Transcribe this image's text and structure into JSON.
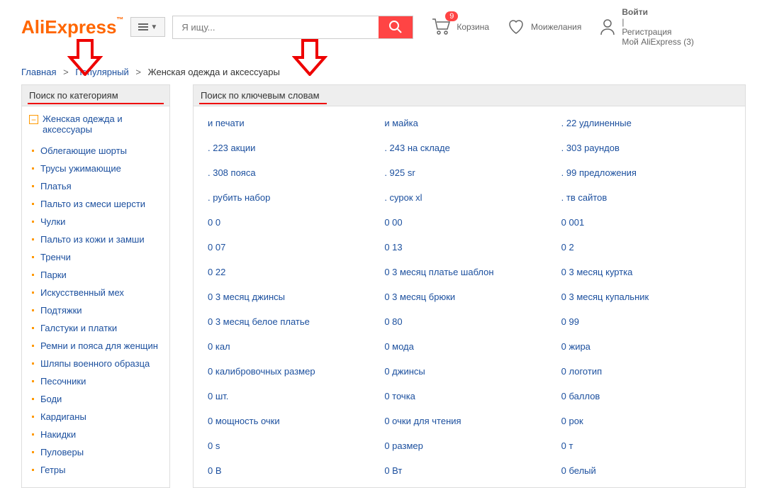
{
  "header": {
    "logo": {
      "ali": "Ali",
      "express": "Express",
      "tm": "™"
    },
    "search": {
      "placeholder": "Я ищу..."
    },
    "cart": {
      "count": "9",
      "label": "Корзина"
    },
    "wishlist": {
      "top": "Мои",
      "bot": "желания"
    },
    "account": {
      "login": "Войти",
      "sep": "|",
      "register": "Регистрация",
      "my": "Мой AliExpress (3)"
    }
  },
  "breadcrumb": {
    "home": "Главная",
    "popular": "Популярный",
    "current": "Женская одежда и аксессуары"
  },
  "sidebar": {
    "title": "Поиск по категориям",
    "root_label": "Женская одежда и аксессуары",
    "items": [
      "Облегающие шорты",
      "Трусы ужимающие",
      "Платья",
      "Пальто из смеси шерсти",
      "Чулки",
      "Пальто из кожи и замши",
      "Тренчи",
      "Парки",
      "Искусственный мех",
      "Подтяжки",
      "Галстуки и платки",
      "Ремни и пояса для женщин",
      "Шляпы военного образца",
      "Песочники",
      "Боди",
      "Кардиганы",
      "Накидки",
      "Пуловеры",
      "Гетры"
    ]
  },
  "main": {
    "title": "Поиск по ключевым словам",
    "keywords": [
      "и печати",
      "и майка",
      ". 22 удлиненные",
      ". 223 акции",
      ". 243 на складе",
      ". 303 раундов",
      ". 308 пояса",
      ". 925 sr",
      ". 99 предложения",
      ". рубить набор",
      ". сурок xl",
      ". тв сайтов",
      "0 0",
      "0 00",
      "0 001",
      "0 07",
      "0 13",
      "0 2",
      "0 22",
      "0 3 месяц платье шаблон",
      "0 3 месяц куртка",
      "0 3 месяц джинсы",
      "0 3 месяц брюки",
      "0 3 месяц купальник",
      "0 3 месяц белое платье",
      "0 80",
      "0 99",
      "0 кал",
      "0 мода",
      "0 жира",
      "0 калибровочных размер",
      "0 джинсы",
      "0 логотип",
      "0 шт.",
      "0 точка",
      "0 баллов",
      "0 мощность очки",
      "0 очки для чтения",
      "0 рок",
      "0 s",
      "0 размер",
      "0 т",
      "0 В",
      "0 Вт",
      "0 белый"
    ]
  }
}
